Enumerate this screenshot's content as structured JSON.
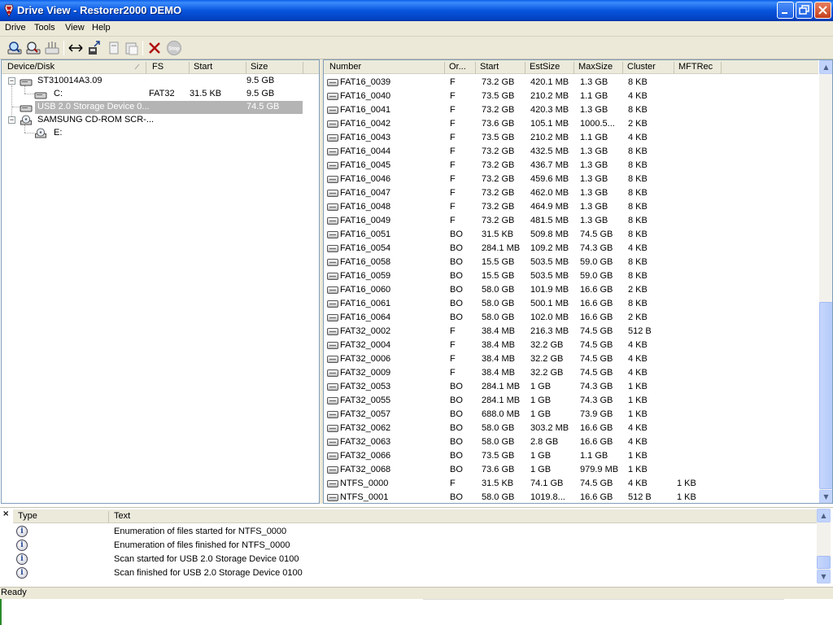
{
  "window": {
    "title": "Drive View - Restorer2000 DEMO",
    "buttons": {
      "minimize": "minimize",
      "maximize": "restore",
      "close": "close"
    }
  },
  "menu": [
    "Drive",
    "Tools",
    "View",
    "Help"
  ],
  "toolbar": {
    "icons": [
      "scan-icon",
      "search-disk-icon",
      "disk-tools-icon",
      "resize-icon",
      "export-icon",
      "copy-icon",
      "paste-icon",
      "delete-icon",
      "stop-icon"
    ],
    "stop_label": "Stop"
  },
  "tree": {
    "headers": [
      "Device/Disk",
      "FS",
      "Start",
      "Size"
    ],
    "rows": [
      {
        "label": "ST310014A3.09",
        "fs": "",
        "start": "",
        "size": "9.5 GB",
        "level": 0,
        "expander": "−",
        "icon": "hard-disk-icon",
        "selected": false
      },
      {
        "label": "C:",
        "fs": "FAT32",
        "start": "31.5 KB",
        "size": "9.5 GB",
        "level": 1,
        "expander": "",
        "icon": "partition-icon",
        "selected": false
      },
      {
        "label": "USB 2.0 Storage Device 0...",
        "fs": "",
        "start": "",
        "size": "74.5 GB",
        "level": 0,
        "expander": "",
        "icon": "usb-disk-icon",
        "selected": true
      },
      {
        "label": "SAMSUNG CD-ROM SCR-...",
        "fs": "",
        "start": "",
        "size": "",
        "level": 0,
        "expander": "−",
        "icon": "cdrom-icon",
        "selected": false
      },
      {
        "label": "E:",
        "fs": "",
        "start": "",
        "size": "",
        "level": 1,
        "expander": "",
        "icon": "cd-drive-icon",
        "selected": false
      }
    ]
  },
  "list": {
    "headers": [
      "Number",
      "Or...",
      "Start",
      "EstSize",
      "MaxSize",
      "Cluster",
      "MFTRec"
    ],
    "rows": [
      [
        "FAT16_0039",
        "F",
        "73.2 GB",
        "420.1 MB",
        "1.3 GB",
        "8 KB",
        ""
      ],
      [
        "FAT16_0040",
        "F",
        "73.5 GB",
        "210.2 MB",
        "1.1 GB",
        "4 KB",
        ""
      ],
      [
        "FAT16_0041",
        "F",
        "73.2 GB",
        "420.3 MB",
        "1.3 GB",
        "8 KB",
        ""
      ],
      [
        "FAT16_0042",
        "F",
        "73.6 GB",
        "105.1 MB",
        "1000.5...",
        "2 KB",
        ""
      ],
      [
        "FAT16_0043",
        "F",
        "73.5 GB",
        "210.2 MB",
        "1.1 GB",
        "4 KB",
        ""
      ],
      [
        "FAT16_0044",
        "F",
        "73.2 GB",
        "432.5 MB",
        "1.3 GB",
        "8 KB",
        ""
      ],
      [
        "FAT16_0045",
        "F",
        "73.2 GB",
        "436.7 MB",
        "1.3 GB",
        "8 KB",
        ""
      ],
      [
        "FAT16_0046",
        "F",
        "73.2 GB",
        "459.6 MB",
        "1.3 GB",
        "8 KB",
        ""
      ],
      [
        "FAT16_0047",
        "F",
        "73.2 GB",
        "462.0 MB",
        "1.3 GB",
        "8 KB",
        ""
      ],
      [
        "FAT16_0048",
        "F",
        "73.2 GB",
        "464.9 MB",
        "1.3 GB",
        "8 KB",
        ""
      ],
      [
        "FAT16_0049",
        "F",
        "73.2 GB",
        "481.5 MB",
        "1.3 GB",
        "8 KB",
        ""
      ],
      [
        "FAT16_0051",
        "BO",
        "31.5 KB",
        "509.8 MB",
        "74.5 GB",
        "8 KB",
        ""
      ],
      [
        "FAT16_0054",
        "BO",
        "284.1 MB",
        "109.2 MB",
        "74.3 GB",
        "4 KB",
        ""
      ],
      [
        "FAT16_0058",
        "BO",
        "15.5 GB",
        "503.5 MB",
        "59.0 GB",
        "8 KB",
        ""
      ],
      [
        "FAT16_0059",
        "BO",
        "15.5 GB",
        "503.5 MB",
        "59.0 GB",
        "8 KB",
        ""
      ],
      [
        "FAT16_0060",
        "BO",
        "58.0 GB",
        "101.9 MB",
        "16.6 GB",
        "2 KB",
        ""
      ],
      [
        "FAT16_0061",
        "BO",
        "58.0 GB",
        "500.1 MB",
        "16.6 GB",
        "8 KB",
        ""
      ],
      [
        "FAT16_0064",
        "BO",
        "58.0 GB",
        "102.0 MB",
        "16.6 GB",
        "2 KB",
        ""
      ],
      [
        "FAT32_0002",
        "F",
        "38.4 MB",
        "216.3 MB",
        "74.5 GB",
        "512 B",
        ""
      ],
      [
        "FAT32_0004",
        "F",
        "38.4 MB",
        "32.2 GB",
        "74.5 GB",
        "4 KB",
        ""
      ],
      [
        "FAT32_0006",
        "F",
        "38.4 MB",
        "32.2 GB",
        "74.5 GB",
        "4 KB",
        ""
      ],
      [
        "FAT32_0009",
        "F",
        "38.4 MB",
        "32.2 GB",
        "74.5 GB",
        "4 KB",
        ""
      ],
      [
        "FAT32_0053",
        "BO",
        "284.1 MB",
        "1 GB",
        "74.3 GB",
        "1 KB",
        ""
      ],
      [
        "FAT32_0055",
        "BO",
        "284.1 MB",
        "1 GB",
        "74.3 GB",
        "1 KB",
        ""
      ],
      [
        "FAT32_0057",
        "BO",
        "688.0 MB",
        "1 GB",
        "73.9 GB",
        "1 KB",
        ""
      ],
      [
        "FAT32_0062",
        "BO",
        "58.0 GB",
        "303.2 MB",
        "16.6 GB",
        "4 KB",
        ""
      ],
      [
        "FAT32_0063",
        "BO",
        "58.0 GB",
        "2.8 GB",
        "16.6 GB",
        "4 KB",
        ""
      ],
      [
        "FAT32_0066",
        "BO",
        "73.5 GB",
        "1 GB",
        "1.1 GB",
        "1 KB",
        ""
      ],
      [
        "FAT32_0068",
        "BO",
        "73.6 GB",
        "1 GB",
        "979.9 MB",
        "1 KB",
        ""
      ],
      [
        "NTFS_0000",
        "F",
        "31.5 KB",
        "74.1 GB",
        "74.5 GB",
        "4 KB",
        "1 KB"
      ],
      [
        "NTFS_0001",
        "BO",
        "58.0 GB",
        "1019.8...",
        "16.6 GB",
        "512 B",
        "1 KB"
      ]
    ]
  },
  "log": {
    "close_label": "×",
    "headers": [
      "Type",
      "Text"
    ],
    "rows": [
      {
        "type": "info-icon",
        "text": "Enumeration of files started for NTFS_0000"
      },
      {
        "type": "info-icon",
        "text": "Enumeration of files finished for NTFS_0000"
      },
      {
        "type": "info-icon",
        "text": "Scan started for USB 2.0 Storage Device 0100"
      },
      {
        "type": "info-icon",
        "text": "Scan finished for USB 2.0 Storage Device 0100"
      }
    ]
  },
  "status": "Ready",
  "colors": {
    "titlebar": "#0855dd",
    "chrome": "#ece9d8",
    "selection": "#b4b4b4",
    "border": "#7f9db9"
  }
}
